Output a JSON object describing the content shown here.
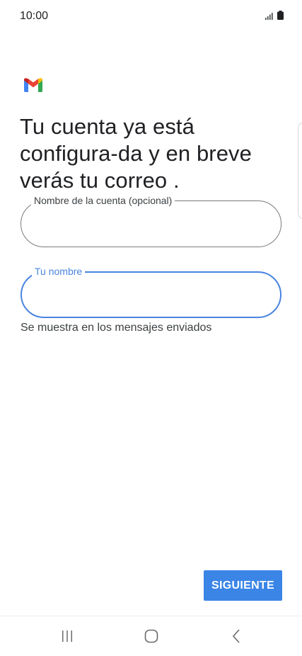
{
  "status_bar": {
    "time": "10:00"
  },
  "heading": "Tu cuenta ya está configura-da y en breve verás tu correo .",
  "fields": {
    "account_name": {
      "label": "Nombre de la cuenta (opcional)",
      "value": ""
    },
    "your_name": {
      "label": "Tu nombre",
      "value": ""
    }
  },
  "helper_text": "Se muestra en los mensajes enviados",
  "next_button_label": "SIGUIENTE",
  "colors": {
    "accent": "#4a84e0",
    "button": "#3a85e6",
    "text": "#202124"
  },
  "nav_bar": {
    "icons": [
      "recents-icon",
      "home-icon",
      "back-icon"
    ]
  }
}
